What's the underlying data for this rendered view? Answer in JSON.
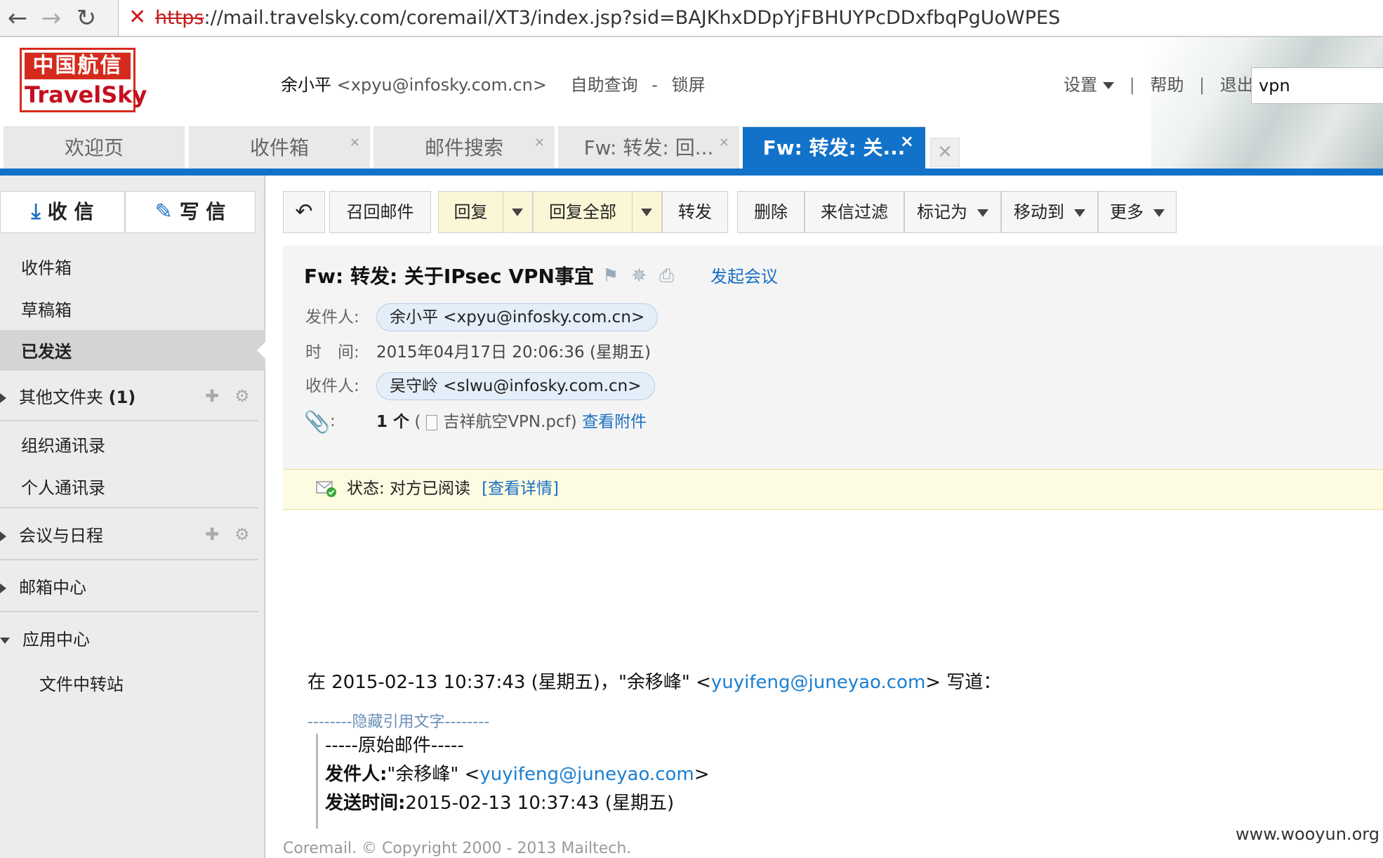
{
  "browser": {
    "url_scheme": "https",
    "url_rest": "://mail.travelsky.com/coremail/XT3/index.jsp?sid=BAJKhxDDpYjFBHUYPcDDxfbqPgUoWPES"
  },
  "logo": {
    "cn": "中国航信",
    "en": "TravelSky"
  },
  "header": {
    "user_name": "余小平",
    "user_email": "<xpyu@infosky.com.cn>",
    "self_query": "自助查询",
    "dash": "-",
    "lock_screen": "锁屏",
    "settings": "设置",
    "help": "帮助",
    "logout": "退出",
    "pipe": "|",
    "search_value": "vpn"
  },
  "tabs": [
    {
      "label": "欢迎页"
    },
    {
      "label": "收件箱",
      "close": "×"
    },
    {
      "label": "邮件搜索",
      "close": "×"
    },
    {
      "label": "Fw: 转发: 回...",
      "close": "×"
    },
    {
      "label": "Fw: 转发: 关...",
      "close": "×"
    }
  ],
  "sidebar": {
    "receive": "收 信",
    "compose": "写 信",
    "inbox": "收件箱",
    "drafts": "草稿箱",
    "sent": "已发送",
    "other_folders": "其他文件夹",
    "other_count": "(1)",
    "org_contacts": "组织通讯录",
    "personal_contacts": "个人通讯录",
    "meetings": "会议与日程",
    "mailbox_center": "邮箱中心",
    "app_center": "应用中心",
    "file_transfer": "文件中转站"
  },
  "toolbar": {
    "recall": "召回邮件",
    "reply": "回复",
    "reply_all": "回复全部",
    "forward": "转发",
    "delete": "删除",
    "filter": "来信过滤",
    "mark_as": "标记为",
    "move_to": "移动到",
    "more": "更多"
  },
  "mail": {
    "subject": "Fw: 转发: 关于IPsec VPN事宜",
    "start_meeting": "发起会议",
    "from_label": "发件人:",
    "from_value": "余小平 <xpyu@infosky.com.cn>",
    "time_label": "时　间:",
    "time_value": "2015年04月17日 20:06:36 (星期五)",
    "to_label": "收件人:",
    "to_value": "吴守岭 <slwu@infosky.com.cn>",
    "attach_colon": ":",
    "attach_count": "1 个",
    "attach_open": "(",
    "attach_name": "吉祥航空VPN.pcf)",
    "attach_view": "查看附件",
    "status": "状态: 对方已阅读",
    "status_link": "[查看详情]"
  },
  "body": {
    "line1_prefix": "在 2015-02-13 10:37:43 (星期五)，\"余移峰\" <",
    "line1_email": "yuyifeng@juneyao.com",
    "line1_suffix": "> 写道：",
    "hidden_quote": "--------隐藏引用文字--------",
    "orig_header": "-----原始邮件-----",
    "from_label": "发件人:",
    "from_name": "\"余移峰\" <",
    "from_email": "yuyifeng@juneyao.com",
    "from_close": ">",
    "sent_label": "发送时间:",
    "sent_value": "2015-02-13 10:37:43 (星期五)"
  },
  "footer": "Coremail. © Copyright 2000 - 2013 Mailtech.",
  "watermark": "www.wooyun.org"
}
